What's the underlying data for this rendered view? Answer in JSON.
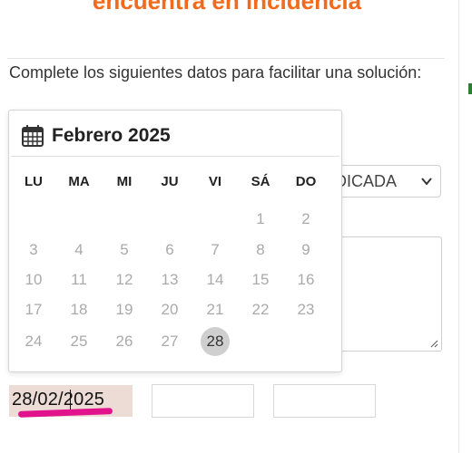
{
  "page": {
    "heading": "encuentra en incidencia",
    "intro": "Complete los siguientes datos para facilitar una solución:"
  },
  "form": {
    "select_value": "DICADA",
    "date_value": "28/02/2025"
  },
  "calendar": {
    "title": "Febrero 2025",
    "weekdays": [
      "LU",
      "MA",
      "MI",
      "JU",
      "VI",
      "SÁ",
      "DO"
    ],
    "days": [
      "1",
      "2",
      "3",
      "4",
      "5",
      "6",
      "7",
      "8",
      "9",
      "10",
      "11",
      "12",
      "13",
      "14",
      "15",
      "16",
      "17",
      "18",
      "19",
      "20",
      "21",
      "22",
      "23",
      "24",
      "25",
      "26",
      "27",
      "28"
    ],
    "first_weekday_index": 5,
    "selected_day": "28"
  },
  "colors": {
    "heading": "#f26a1b",
    "highlight_underline": "#e0138c",
    "date_field_bg": "#ecdcd5",
    "selected_day_bg": "#cfcfcf"
  }
}
